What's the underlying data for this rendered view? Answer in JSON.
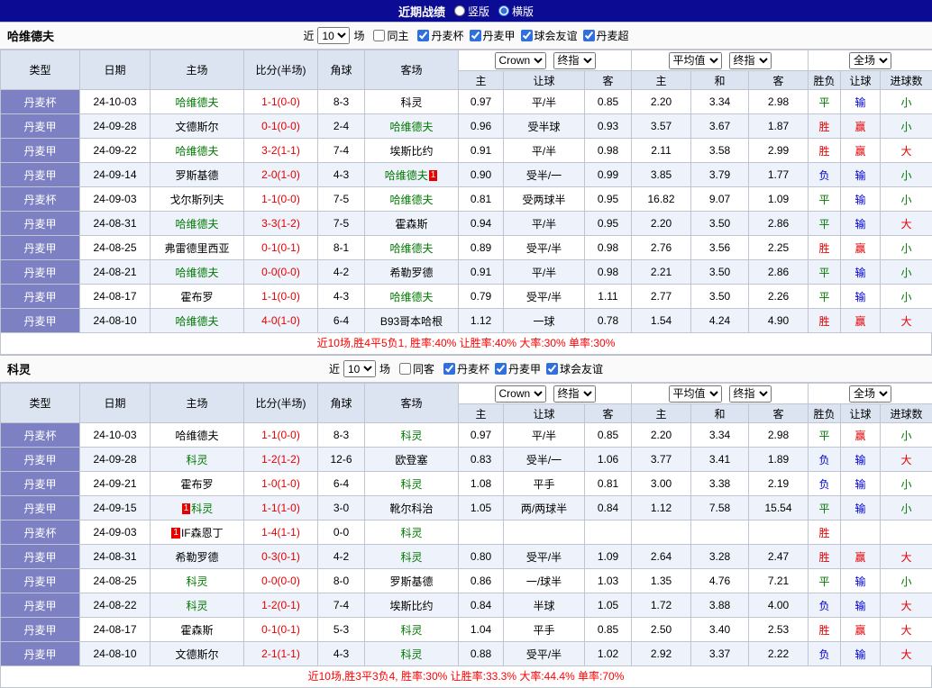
{
  "titlebar": {
    "title": "近期战绩",
    "radio_vertical": "竖版",
    "radio_horizontal": "横版",
    "selected": "横版"
  },
  "colors": {
    "topbar_bg": "#0b0b93",
    "type_col_bg": "#7e80c4",
    "header_bg": "#dbe4f0",
    "row_alt_bg": "#edf2fb",
    "focus_team": "#007a00",
    "score": "#e60000",
    "win": "#e60000",
    "draw": "#007a00",
    "lose": "#0000d0",
    "summary_text": "#ff0000"
  },
  "filter_shared": {
    "near_label": "近",
    "count": "10",
    "games_label": "场"
  },
  "table": {
    "headers": {
      "type": "类型",
      "date": "日期",
      "home": "主场",
      "score": "比分(半场)",
      "corner": "角球",
      "away": "客场",
      "odds_home": "主",
      "odds_handicap": "让球",
      "odds_away": "客",
      "eu_home": "主",
      "eu_draw": "和",
      "eu_away": "客",
      "result": "胜负",
      "handicap_result": "让球",
      "goals": "进球数"
    },
    "selects": {
      "odds_provider": "Crown",
      "odds_final": "终指",
      "europe_avg": "平均值",
      "europe_final": "终指",
      "scope": "全场"
    }
  },
  "result_colors": {
    "胜": "red",
    "负": "blue",
    "平": "green",
    "赢": "red",
    "输": "blue",
    "大": "red",
    "小": "green"
  },
  "sections": [
    {
      "team": "哈维德夫",
      "filter": {
        "same_label": "同主",
        "same_checked": false,
        "leagues": [
          {
            "label": "丹麦杯",
            "checked": true
          },
          {
            "label": "丹麦甲",
            "checked": true
          },
          {
            "label": "球会友谊",
            "checked": true
          },
          {
            "label": "丹麦超",
            "checked": true
          }
        ]
      },
      "rows": [
        {
          "type": "丹麦杯",
          "date": "24-10-03",
          "home": "哈维德夫",
          "home_focus": true,
          "score": "1-1(0-0)",
          "corner": "8-3",
          "away": "科灵",
          "away_focus": false,
          "w": "0.97",
          "handicap": "平/半",
          "l": "0.85",
          "eh": "2.20",
          "ed": "3.34",
          "ea": "2.98",
          "result": "平",
          "hres": "输",
          "goals": "小"
        },
        {
          "type": "丹麦甲",
          "date": "24-09-28",
          "home": "文德斯尔",
          "home_focus": false,
          "score": "0-1(0-0)",
          "corner": "2-4",
          "away": "哈维德夫",
          "away_focus": true,
          "w": "0.96",
          "handicap": "受半球",
          "l": "0.93",
          "eh": "3.57",
          "ed": "3.67",
          "ea": "1.87",
          "result": "胜",
          "hres": "赢",
          "goals": "小"
        },
        {
          "type": "丹麦甲",
          "date": "24-09-22",
          "home": "哈维德夫",
          "home_focus": true,
          "score": "3-2(1-1)",
          "corner": "7-4",
          "away": "埃斯比约",
          "away_focus": false,
          "w": "0.91",
          "handicap": "平/半",
          "l": "0.98",
          "eh": "2.11",
          "ed": "3.58",
          "ea": "2.99",
          "result": "胜",
          "hres": "赢",
          "goals": "大"
        },
        {
          "type": "丹麦甲",
          "date": "24-09-14",
          "home": "罗斯基德",
          "home_focus": false,
          "score": "2-0(1-0)",
          "corner": "4-3",
          "away": "哈维德夫",
          "away_focus": true,
          "away_badge": "1",
          "away_badge_pos": "after",
          "w": "0.90",
          "handicap": "受半/一",
          "l": "0.99",
          "eh": "3.85",
          "ed": "3.79",
          "ea": "1.77",
          "result": "负",
          "hres": "输",
          "goals": "小"
        },
        {
          "type": "丹麦杯",
          "date": "24-09-03",
          "home": "戈尔斯列夫",
          "home_focus": false,
          "score": "1-1(0-0)",
          "corner": "7-5",
          "away": "哈维德夫",
          "away_focus": true,
          "w": "0.81",
          "handicap": "受两球半",
          "l": "0.95",
          "eh": "16.82",
          "ed": "9.07",
          "ea": "1.09",
          "result": "平",
          "hres": "输",
          "goals": "小"
        },
        {
          "type": "丹麦甲",
          "date": "24-08-31",
          "home": "哈维德夫",
          "home_focus": true,
          "score": "3-3(1-2)",
          "corner": "7-5",
          "away": "霍森斯",
          "away_focus": false,
          "w": "0.94",
          "handicap": "平/半",
          "l": "0.95",
          "eh": "2.20",
          "ed": "3.50",
          "ea": "2.86",
          "result": "平",
          "hres": "输",
          "goals": "大"
        },
        {
          "type": "丹麦甲",
          "date": "24-08-25",
          "home": "弗雷德里西亚",
          "home_focus": false,
          "score": "0-1(0-1)",
          "corner": "8-1",
          "away": "哈维德夫",
          "away_focus": true,
          "w": "0.89",
          "handicap": "受平/半",
          "l": "0.98",
          "eh": "2.76",
          "ed": "3.56",
          "ea": "2.25",
          "result": "胜",
          "hres": "赢",
          "goals": "小"
        },
        {
          "type": "丹麦甲",
          "date": "24-08-21",
          "home": "哈维德夫",
          "home_focus": true,
          "score": "0-0(0-0)",
          "corner": "4-2",
          "away": "希勒罗德",
          "away_focus": false,
          "w": "0.91",
          "handicap": "平/半",
          "l": "0.98",
          "eh": "2.21",
          "ed": "3.50",
          "ea": "2.86",
          "result": "平",
          "hres": "输",
          "goals": "小"
        },
        {
          "type": "丹麦甲",
          "date": "24-08-17",
          "home": "霍布罗",
          "home_focus": false,
          "score": "1-1(0-0)",
          "corner": "4-3",
          "away": "哈维德夫",
          "away_focus": true,
          "w": "0.79",
          "handicap": "受平/半",
          "l": "1.11",
          "eh": "2.77",
          "ed": "3.50",
          "ea": "2.26",
          "result": "平",
          "hres": "输",
          "goals": "小"
        },
        {
          "type": "丹麦甲",
          "date": "24-08-10",
          "home": "哈维德夫",
          "home_focus": true,
          "score": "4-0(1-0)",
          "corner": "6-4",
          "away": "B93哥本哈根",
          "away_focus": false,
          "w": "1.12",
          "handicap": "一球",
          "l": "0.78",
          "eh": "1.54",
          "ed": "4.24",
          "ea": "4.90",
          "result": "胜",
          "hres": "赢",
          "goals": "大"
        }
      ],
      "summary": "近10场,胜4平5负1, 胜率:40% 让胜率:40% 大率:30% 单率:30%"
    },
    {
      "team": "科灵",
      "filter": {
        "same_label": "同客",
        "same_checked": false,
        "leagues": [
          {
            "label": "丹麦杯",
            "checked": true
          },
          {
            "label": "丹麦甲",
            "checked": true
          },
          {
            "label": "球会友谊",
            "checked": true
          }
        ]
      },
      "rows": [
        {
          "type": "丹麦杯",
          "date": "24-10-03",
          "home": "哈维德夫",
          "home_focus": false,
          "score": "1-1(0-0)",
          "corner": "8-3",
          "away": "科灵",
          "away_focus": true,
          "w": "0.97",
          "handicap": "平/半",
          "l": "0.85",
          "eh": "2.20",
          "ed": "3.34",
          "ea": "2.98",
          "result": "平",
          "hres": "赢",
          "goals": "小"
        },
        {
          "type": "丹麦甲",
          "date": "24-09-28",
          "home": "科灵",
          "home_focus": true,
          "score": "1-2(1-2)",
          "corner": "12-6",
          "away": "欧登塞",
          "away_focus": false,
          "w": "0.83",
          "handicap": "受半/一",
          "l": "1.06",
          "eh": "3.77",
          "ed": "3.41",
          "ea": "1.89",
          "result": "负",
          "hres": "输",
          "goals": "大"
        },
        {
          "type": "丹麦甲",
          "date": "24-09-21",
          "home": "霍布罗",
          "home_focus": false,
          "score": "1-0(1-0)",
          "corner": "6-4",
          "away": "科灵",
          "away_focus": true,
          "w": "1.08",
          "handicap": "平手",
          "l": "0.81",
          "eh": "3.00",
          "ed": "3.38",
          "ea": "2.19",
          "result": "负",
          "hres": "输",
          "goals": "小"
        },
        {
          "type": "丹麦甲",
          "date": "24-09-15",
          "home": "科灵",
          "home_focus": true,
          "home_badge": "1",
          "home_badge_pos": "before",
          "score": "1-1(1-0)",
          "corner": "3-0",
          "away": "靴尔科治",
          "away_focus": false,
          "w": "1.05",
          "handicap": "两/两球半",
          "l": "0.84",
          "eh": "1.12",
          "ed": "7.58",
          "ea": "15.54",
          "result": "平",
          "hres": "输",
          "goals": "小"
        },
        {
          "type": "丹麦杯",
          "date": "24-09-03",
          "home": "IF森恩丁",
          "home_focus": false,
          "home_badge": "1",
          "home_badge_pos": "before",
          "score": "1-4(1-1)",
          "corner": "0-0",
          "away": "科灵",
          "away_focus": true,
          "w": "",
          "handicap": "",
          "l": "",
          "eh": "",
          "ed": "",
          "ea": "",
          "result": "胜",
          "hres": "",
          "goals": ""
        },
        {
          "type": "丹麦甲",
          "date": "24-08-31",
          "home": "希勒罗德",
          "home_focus": false,
          "score": "0-3(0-1)",
          "corner": "4-2",
          "away": "科灵",
          "away_focus": true,
          "w": "0.80",
          "handicap": "受平/半",
          "l": "1.09",
          "eh": "2.64",
          "ed": "3.28",
          "ea": "2.47",
          "result": "胜",
          "hres": "赢",
          "goals": "大"
        },
        {
          "type": "丹麦甲",
          "date": "24-08-25",
          "home": "科灵",
          "home_focus": true,
          "score": "0-0(0-0)",
          "corner": "8-0",
          "away": "罗斯基德",
          "away_focus": false,
          "w": "0.86",
          "handicap": "一/球半",
          "l": "1.03",
          "eh": "1.35",
          "ed": "4.76",
          "ea": "7.21",
          "result": "平",
          "hres": "输",
          "goals": "小"
        },
        {
          "type": "丹麦甲",
          "date": "24-08-22",
          "home": "科灵",
          "home_focus": true,
          "score": "1-2(0-1)",
          "corner": "7-4",
          "away": "埃斯比约",
          "away_focus": false,
          "w": "0.84",
          "handicap": "半球",
          "l": "1.05",
          "eh": "1.72",
          "ed": "3.88",
          "ea": "4.00",
          "result": "负",
          "hres": "输",
          "goals": "大"
        },
        {
          "type": "丹麦甲",
          "date": "24-08-17",
          "home": "霍森斯",
          "home_focus": false,
          "score": "0-1(0-1)",
          "corner": "5-3",
          "away": "科灵",
          "away_focus": true,
          "w": "1.04",
          "handicap": "平手",
          "l": "0.85",
          "eh": "2.50",
          "ed": "3.40",
          "ea": "2.53",
          "result": "胜",
          "hres": "赢",
          "goals": "大"
        },
        {
          "type": "丹麦甲",
          "date": "24-08-10",
          "home": "文德斯尔",
          "home_focus": false,
          "score": "2-1(1-1)",
          "corner": "4-3",
          "away": "科灵",
          "away_focus": true,
          "w": "0.88",
          "handicap": "受平/半",
          "l": "1.02",
          "eh": "2.92",
          "ed": "3.37",
          "ea": "2.22",
          "result": "负",
          "hres": "输",
          "goals": "大"
        }
      ],
      "summary": "近10场,胜3平3负4, 胜率:30% 让胜率:33.3% 大率:44.4% 单率:70%"
    }
  ]
}
